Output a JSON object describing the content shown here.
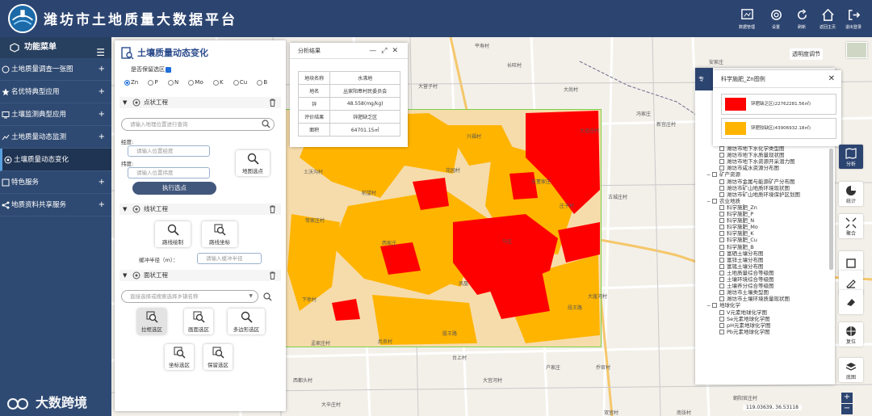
{
  "header": {
    "title": "潍坊市土地质量大数据平台",
    "tools": [
      {
        "label": "数据管理",
        "icon": "data-manage-icon"
      },
      {
        "label": "设置",
        "icon": "gear-icon"
      },
      {
        "label": "刷新",
        "icon": "refresh-icon"
      },
      {
        "label": "返回主页",
        "icon": "home-icon"
      },
      {
        "label": "退出登录",
        "icon": "logout-icon"
      }
    ]
  },
  "sidebar": {
    "menu_title": "功能菜单",
    "items": [
      {
        "label": "土地质量调查一张图",
        "icon": "survey-icon"
      },
      {
        "label": "名优特典型应用",
        "icon": "star-icon"
      },
      {
        "label": "土壤监测典型应用",
        "icon": "monitor-icon"
      },
      {
        "label": "土地质量动态监测",
        "icon": "dynamic-icon"
      },
      {
        "label": "土壤质量动态变化",
        "icon": "change-icon"
      },
      {
        "label": "特色服务",
        "icon": "service-icon"
      },
      {
        "label": "地质资料共享服务",
        "icon": "share-icon"
      }
    ],
    "active_index": 4,
    "footer": "大数跨境"
  },
  "panel": {
    "title": "土壤质量动态变化",
    "keep_label": "是否保留选区",
    "keep_checked": true,
    "elements": [
      "Zn",
      "P",
      "N",
      "Mo",
      "K",
      "Cu",
      "B"
    ],
    "selected_element": "Zn",
    "point_section": {
      "title": "点状工程",
      "search_placeholder": "请输入地理位置进行查询",
      "lng_label": "经度:",
      "lng_placeholder": "请输入位置经度",
      "lat_label": "纬度:",
      "lat_placeholder": "请输入位置纬度",
      "map_pick_label": "地图选点",
      "execute_label": "执行选点"
    },
    "line_section": {
      "title": "线状工程",
      "draw_label": "路线绘制",
      "coord_label": "路线坐标",
      "buffer_label": "缓冲半径（m）：",
      "buffer_placeholder": "请输入缓冲半径"
    },
    "area_section": {
      "title": "面状工程",
      "select_placeholder": "直接选择或搜索选择乡镇名称",
      "tools": [
        "拉框选区",
        "画面选区",
        "多边形选区",
        "坐标选区",
        "保留选区"
      ],
      "selected_tool": "拉框选区"
    }
  },
  "result": {
    "title": "分析结果",
    "rows": [
      [
        "地块名称",
        "水沸地"
      ],
      [
        "地名",
        "丛家阳皋村民委员会"
      ],
      [
        "锌",
        "48.558(mg/kg)"
      ],
      [
        "评价结果",
        "锌肥缺乏区"
      ],
      [
        "面积",
        "64701.15㎡"
      ]
    ]
  },
  "legend": {
    "title": "科学施肥_Zn图例",
    "items": [
      {
        "label": "锌肥缺乏区(22762281.56㎡)",
        "color": "#ff0000"
      },
      {
        "label": "锌肥较缺区(43906932.18㎡)",
        "color": "#ffb400"
      }
    ]
  },
  "layers": {
    "tab_label": "专",
    "items": [
      {
        "label": "潍坊市地下水化学类型图",
        "level": 2
      },
      {
        "label": "潍坊市地下水质量现状图",
        "level": 2
      },
      {
        "label": "潍坊市地下水资源开采潜力图",
        "level": 2
      },
      {
        "label": "潍坊市咸水资源分布图",
        "level": 2
      },
      {
        "label": "矿产资源",
        "level": 1,
        "group": true
      },
      {
        "label": "潍坊市金属与能源矿产分布图",
        "level": 2
      },
      {
        "label": "潍坊市矿山地质环境现状图",
        "level": 2
      },
      {
        "label": "潍坊市矿山地质环境保护区划图",
        "level": 2
      },
      {
        "label": "农业地质",
        "level": 1,
        "group": true
      },
      {
        "label": "科学施肥_Zn",
        "level": 2
      },
      {
        "label": "科学施肥_P",
        "level": 2
      },
      {
        "label": "科学施肥_N",
        "level": 2
      },
      {
        "label": "科学施肥_Mo",
        "level": 2
      },
      {
        "label": "科学施肥_K",
        "level": 2
      },
      {
        "label": "科学施肥_Cu",
        "level": 2
      },
      {
        "label": "科学施肥_B",
        "level": 2
      },
      {
        "label": "富硒土壤分布图",
        "level": 2
      },
      {
        "label": "富锌土壤分布图",
        "level": 2
      },
      {
        "label": "富锗土壤分布图",
        "level": 2
      },
      {
        "label": "土地质量综合等级图",
        "level": 2
      },
      {
        "label": "土壤环境综合等级图",
        "level": 2
      },
      {
        "label": "土壤养分综合等级图",
        "level": 2
      },
      {
        "label": "潍坊市土壤类型图",
        "level": 2
      },
      {
        "label": "潍坊市土壤环境质量现状图",
        "level": 2
      },
      {
        "label": "地球化学",
        "level": 1,
        "group": true
      },
      {
        "label": "V元素地球化学图",
        "level": 2
      },
      {
        "label": "Se元素地球化学图",
        "level": 2
      },
      {
        "label": "pH元素地球化学图",
        "level": 2
      },
      {
        "label": "Pb元素地球化学图",
        "level": 2
      }
    ]
  },
  "rightbar": [
    {
      "label": "分析",
      "icon": "analysis-icon",
      "active": true
    },
    {
      "label": "统计",
      "icon": "pie-icon"
    },
    {
      "label": "聚合",
      "icon": "aggregate-icon"
    },
    {
      "label": "",
      "icon": "screenshot-icon"
    },
    {
      "label": "",
      "icon": "draw-icon"
    },
    {
      "label": "",
      "icon": "eraser-icon"
    },
    {
      "label": "复位",
      "icon": "globe-icon"
    },
    {
      "label": "底图",
      "icon": "basemap-icon"
    }
  ],
  "map": {
    "basemap_switch_label": "透明度调节",
    "coords": "119.03639, 36.53118",
    "place_labels": [
      "平寿村",
      "长旺村",
      "安家庄",
      "大营子村",
      "大尚村",
      "冯家庄",
      "新宫庄村",
      "兴福村",
      "大道庄村",
      "土沃沟村",
      "花园村",
      "东董家庄",
      "古城庄村",
      "庄子村",
      "前望村",
      "上桥头村",
      "双新村",
      "常家庄村",
      "马庄",
      "双桥村",
      "大张村",
      "西家庄",
      "丰登村",
      "河北村",
      "下徐村",
      "凤凰",
      "大崖河村",
      "梨花村",
      "股王路",
      "段王路",
      "孟家庄村",
      "后良村",
      "西都头村",
      "北营村",
      "大辛庄",
      "东营村",
      "前家村",
      "小辛店村",
      "八里",
      "东河村",
      "台子",
      "石岭子",
      "台上村",
      "大宫河村",
      "户家庄",
      "乔官村",
      "大辛庄村",
      "朝阳官庄村",
      "双宫村",
      "南张村",
      "大家庄村",
      "大官庄村",
      "东望子村",
      "姜家庄村",
      "刘家庄",
      "东苑村",
      "黑家庄"
    ]
  }
}
